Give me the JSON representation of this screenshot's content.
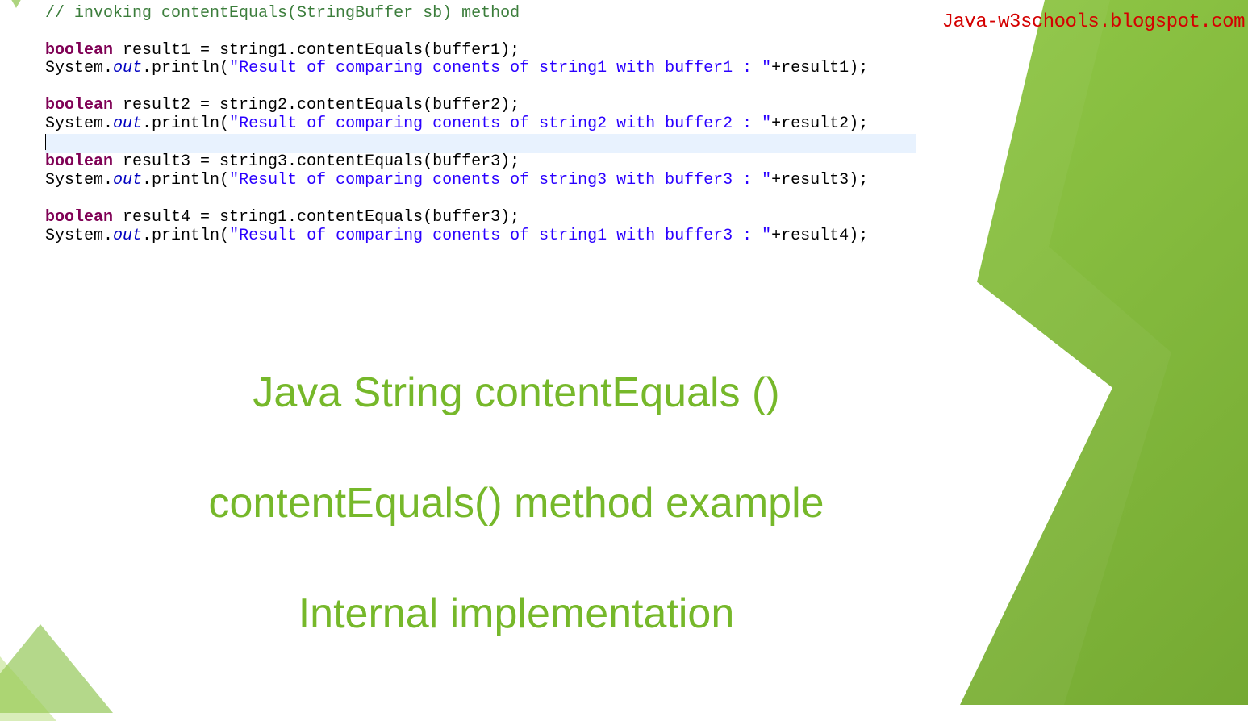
{
  "watermark": "Java-w3schools.blogspot.com",
  "code": {
    "comment": "// invoking contentEquals(StringBuffer sb) method",
    "block1": {
      "decl_kw": "boolean",
      "decl_rest": " result1 = string1.contentEquals(buffer1);",
      "out_pre": "System.",
      "out_fld": "out",
      "out_mid": ".println(",
      "out_str": "\"Result of comparing conents of string1 with buffer1 : \"",
      "out_post": "+result1);"
    },
    "block2": {
      "decl_kw": "boolean",
      "decl_rest": " result2 = string2.contentEquals(buffer2);",
      "out_pre": "System.",
      "out_fld": "out",
      "out_mid": ".println(",
      "out_str": "\"Result of comparing conents of string2 with buffer2 : \"",
      "out_post": "+result2);"
    },
    "block3": {
      "decl_kw": "boolean",
      "decl_rest": " result3 = string3.contentEquals(buffer3);",
      "out_pre": "System.",
      "out_fld": "out",
      "out_mid": ".println(",
      "out_str": "\"Result of comparing conents of string3 with buffer3 : \"",
      "out_post": "+result3);"
    },
    "block4": {
      "decl_kw": "boolean",
      "decl_rest": " result4 = string1.contentEquals(buffer3);",
      "out_pre": "System.",
      "out_fld": "out",
      "out_mid": ".println(",
      "out_str": "\"Result of comparing conents of string1 with buffer3 : \"",
      "out_post": "+result4);"
    }
  },
  "titles": {
    "t1": "Java String contentEquals ()",
    "t2": "contentEquals() method example",
    "t3": "Internal implementation"
  }
}
